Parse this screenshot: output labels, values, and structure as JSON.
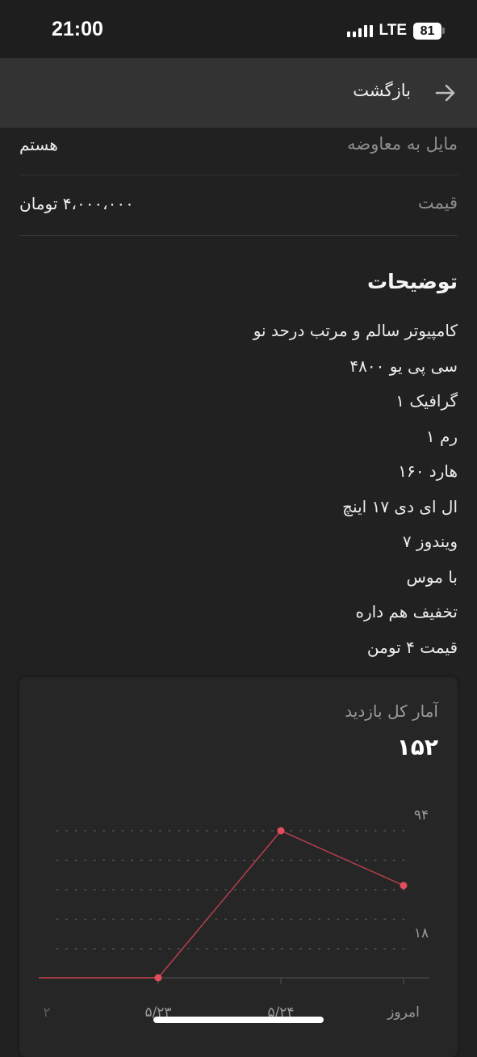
{
  "status_bar": {
    "time": "21:00",
    "network": "LTE",
    "battery": "81"
  },
  "app_bar": {
    "back_label": "بازگشت"
  },
  "details": [
    {
      "label": "مایل به معاوضه",
      "value": "هستم"
    },
    {
      "label": "قیمت",
      "value": "۴،۰۰۰،۰۰۰ تومان"
    }
  ],
  "description": {
    "title": "توضیحات",
    "lines": [
      "کامپیوتر سالم و مرتب درحد نو",
      "سی پی یو ۴۸۰۰",
      "گرافیک ۱",
      "رم ۱",
      "هارد ۱۶۰",
      "ال ای دی ۱۷ اینچ",
      "ویندوز ۷",
      "با موس",
      "تخفیف هم داره",
      "قیمت ۴ تومن"
    ]
  },
  "stats": {
    "title": "آمار کل بازدید",
    "total": "۱۵۲"
  },
  "chart_data": {
    "type": "line",
    "x": [
      "۲",
      "۵/۲۳",
      "۵/۲۴",
      "امروز"
    ],
    "values": [
      0,
      0,
      94,
      59
    ],
    "y_tick_labels": [
      "۹۴",
      "۱۸"
    ],
    "ylim": [
      0,
      94
    ],
    "grid": true,
    "line_color": "#c0404f",
    "point_color": "#e04e5d"
  }
}
